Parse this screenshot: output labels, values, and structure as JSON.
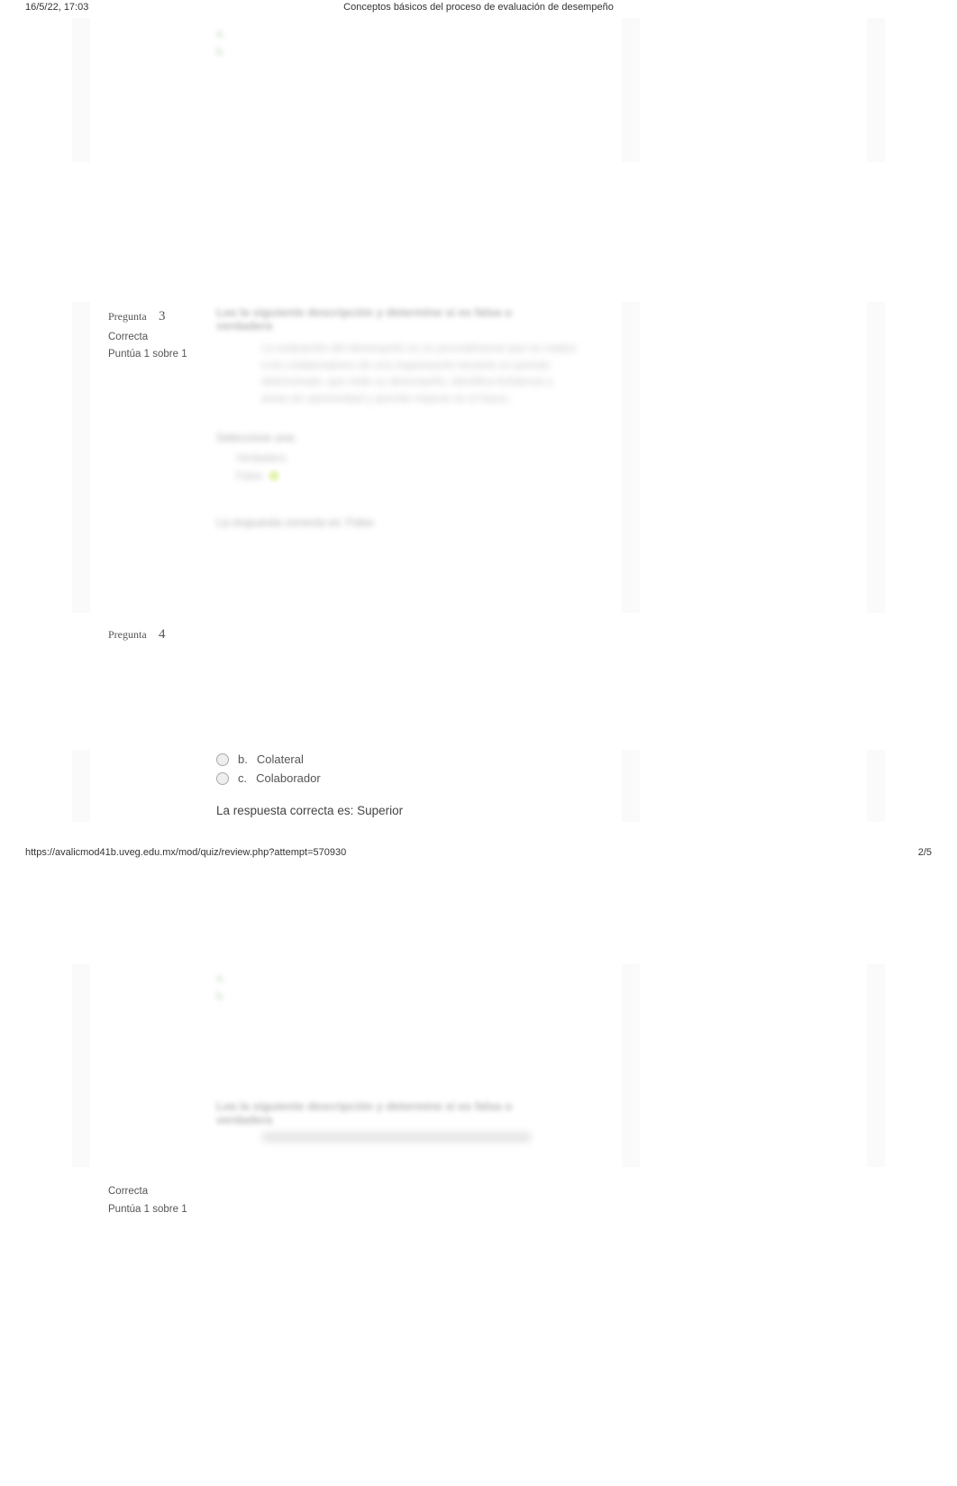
{
  "header": {
    "timestamp": "16/5/22, 17:03",
    "title": "Conceptos básicos del proceso de evaluación de desempeño"
  },
  "footer": {
    "url": "https://avalicmod41b.uveg.edu.mx/mod/quiz/review.php?attempt=570930",
    "page_indicator": "2/5"
  },
  "blurred_snippets": {
    "top_a": "a.",
    "top_b": "b.",
    "q3_prompt_line1": "Lea la siguiente descripción y determine si es falsa o",
    "q3_prompt_line2": "verdadera",
    "q3_paragraph": "La evaluación del desempeño es un procedimiento que se realiza a los colaboradores de una organización durante un periodo determinado, que mide su desempeño, identifica fortalezas y áreas de oportunidad y permite mejorar en el futuro.",
    "q3_select": "Seleccione una:",
    "q3_opt_a": "Verdadero",
    "q3_opt_b": "Falso",
    "q3_feedback": "La respuesta correcta es: Falso",
    "bottom_a": "a.",
    "bottom_b": "b.",
    "q_repeat_line1": "Lea la siguiente descripción y determine si es falsa o",
    "q_repeat_line2": "verdadera"
  },
  "questions": {
    "q3": {
      "label": "Pregunta",
      "number": "3",
      "status": "Correcta",
      "score": "Puntúa 1 sobre 1"
    },
    "q4": {
      "label": "Pregunta",
      "number": "4",
      "options": {
        "b_letter": "b.",
        "b_text": "Colateral",
        "c_letter": "c.",
        "c_text": "Colaborador"
      },
      "feedback": "La respuesta correcta es: Superior"
    },
    "q_lower": {
      "status": "Correcta",
      "score": "Puntúa 1 sobre 1"
    }
  }
}
